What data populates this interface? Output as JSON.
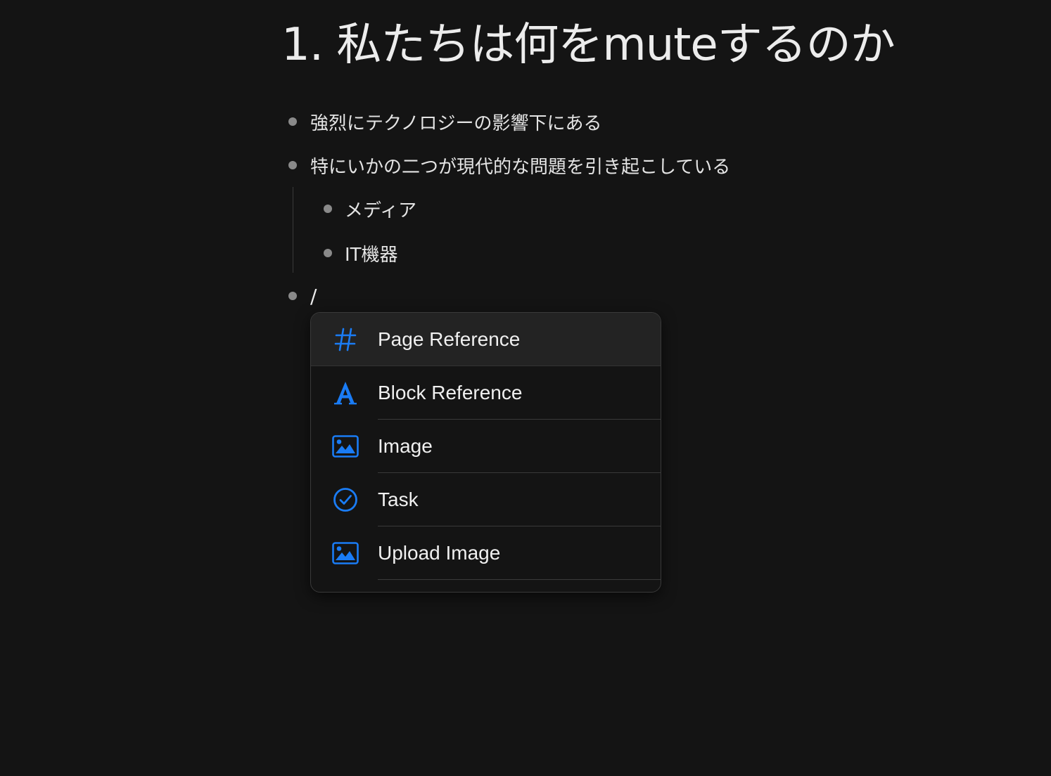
{
  "page": {
    "title": "1. 私たちは何をmuteするのか"
  },
  "blocks": [
    {
      "text": "強烈にテクノロジーの影響下にある"
    },
    {
      "text": "特にいかの二つが現代的な問題を引き起こしている",
      "children": [
        {
          "text": "メディア"
        },
        {
          "text": "IT機器"
        }
      ]
    },
    {
      "text": "/"
    }
  ],
  "slash_menu": {
    "accent_color": "#1a7cf5",
    "selected_index": 0,
    "items": [
      {
        "label": "Page Reference",
        "icon": "hashtag-icon"
      },
      {
        "label": "Block Reference",
        "icon": "letter-a-icon"
      },
      {
        "label": "Image",
        "icon": "image-icon"
      },
      {
        "label": "Task",
        "icon": "checkmark-circle-icon"
      },
      {
        "label": "Upload Image",
        "icon": "image-icon"
      }
    ]
  }
}
